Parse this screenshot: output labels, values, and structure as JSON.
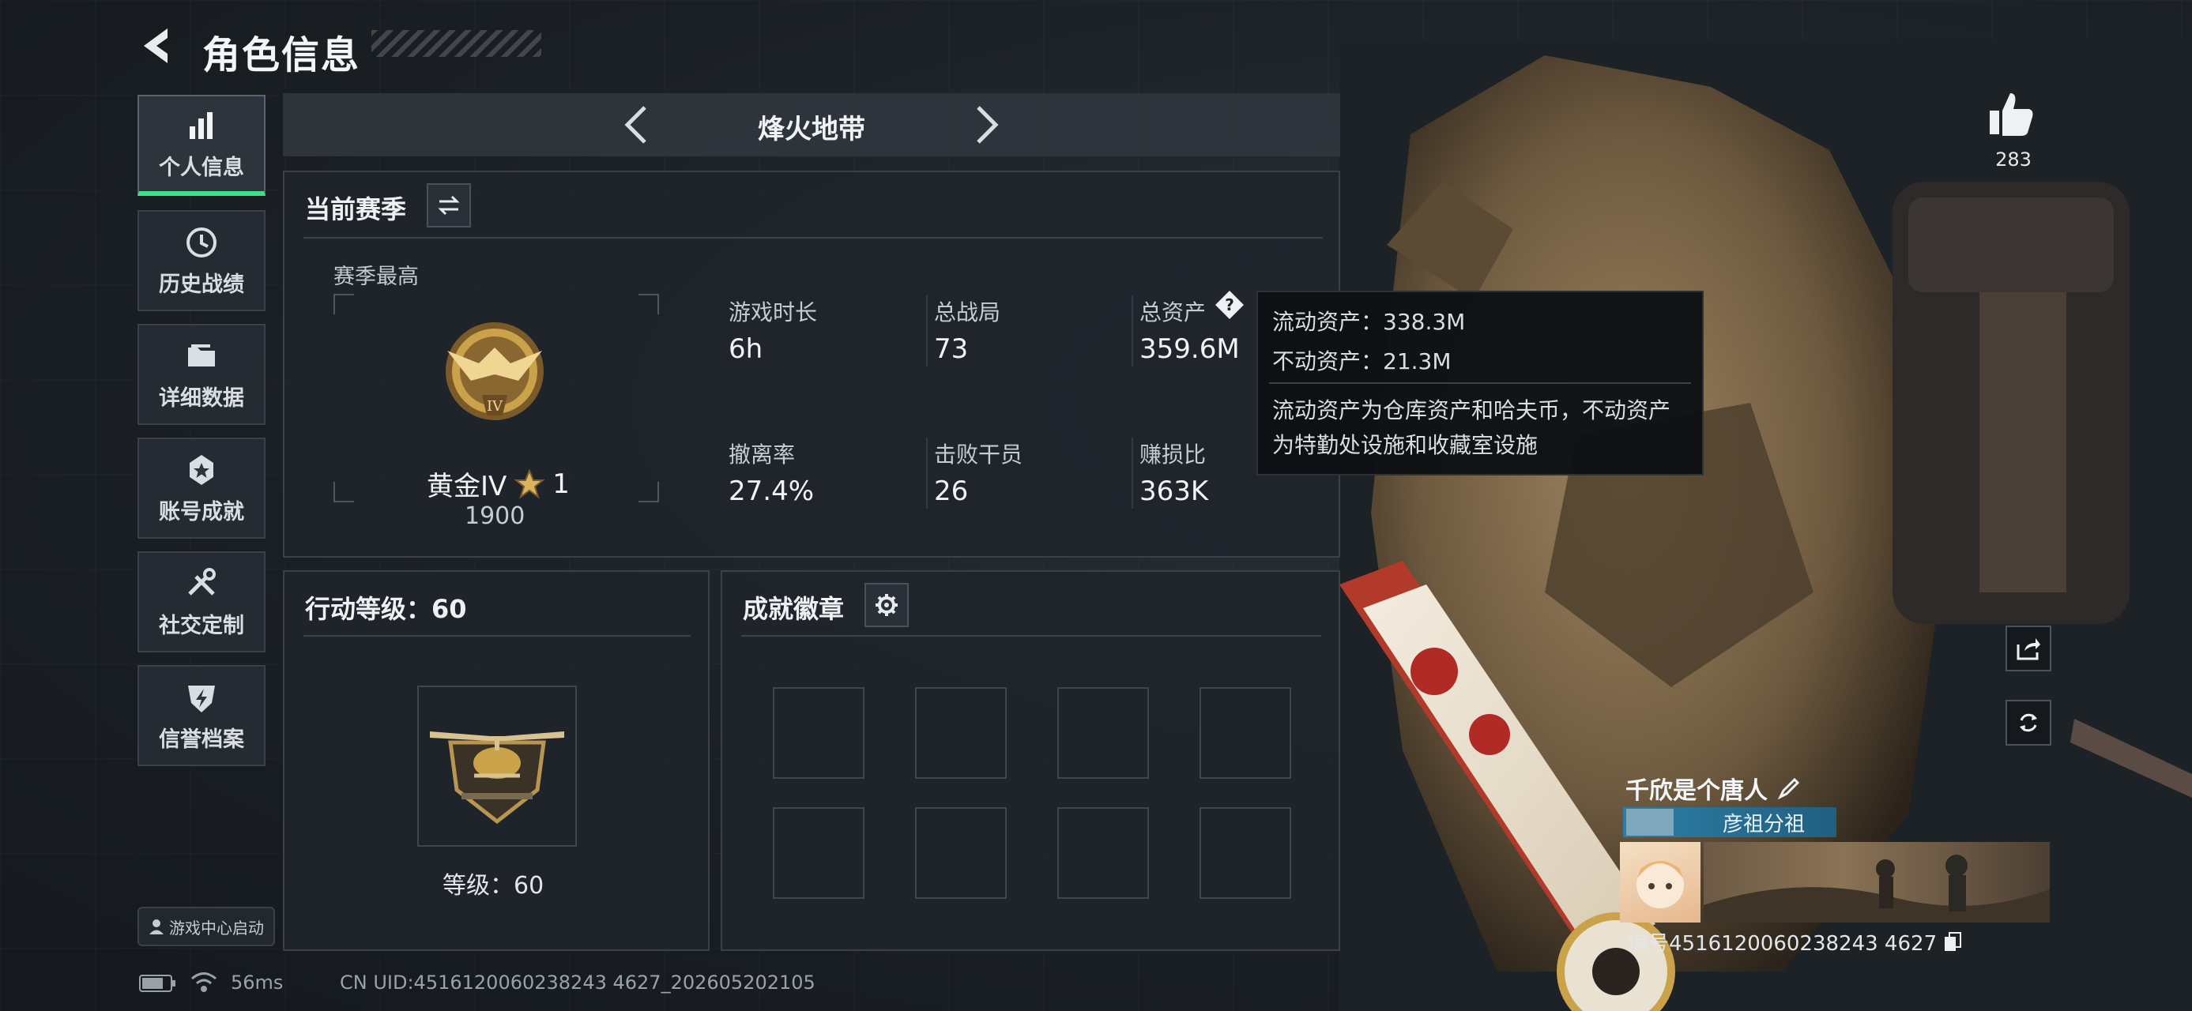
{
  "header": {
    "title": "角色信息"
  },
  "sidebar": {
    "items": [
      {
        "label": "个人信息",
        "icon": "bar-chart-icon",
        "active": true
      },
      {
        "label": "历史战绩",
        "icon": "clock-history-icon"
      },
      {
        "label": "详细数据",
        "icon": "folder-icon"
      },
      {
        "label": "账号成就",
        "icon": "achievement-star-icon"
      },
      {
        "label": "社交定制",
        "icon": "tools-icon"
      },
      {
        "label": "信誉档案",
        "icon": "shield-bolt-icon"
      }
    ],
    "launch_label": "游戏中心启动"
  },
  "map_selector": {
    "name": "烽火地带"
  },
  "season": {
    "title": "当前赛季",
    "best_label": "赛季最高",
    "rank_name": "黄金IV",
    "rank_stars": "1",
    "rank_points": "1900",
    "stats": [
      {
        "label": "游戏时长",
        "value": "6h"
      },
      {
        "label": "总战局",
        "value": "73"
      },
      {
        "label": "总资产",
        "value": "359.6M"
      },
      {
        "label": "撤离率",
        "value": "27.4%"
      },
      {
        "label": "击败干员",
        "value": "26"
      },
      {
        "label": "赚损比",
        "value": "363K"
      }
    ]
  },
  "tooltip": {
    "liquid": "流动资产：338.3M",
    "fixed": "不动资产：21.3M",
    "note_line1": "流动资产为仓库资产和哈夫币，不动资产",
    "note_line2": "为特勤处设施和收藏室设施"
  },
  "action_level": {
    "title": "行动等级：60",
    "level_text": "等级：60"
  },
  "badges": {
    "title": "成就徽章",
    "slot_count": 8
  },
  "status_bar": {
    "ping": "56ms",
    "uid": "CN UID:4516120060238243 4627_202605202105"
  },
  "player": {
    "likes": "283",
    "name": "千欣是个唐人",
    "clan": "彦祖分祖",
    "id_text": "编号4516120060238243 4627"
  },
  "colors": {
    "accent_green": "#3ee08a",
    "clan_blue": "#2d7ea6",
    "gold": "#c9a24a"
  }
}
